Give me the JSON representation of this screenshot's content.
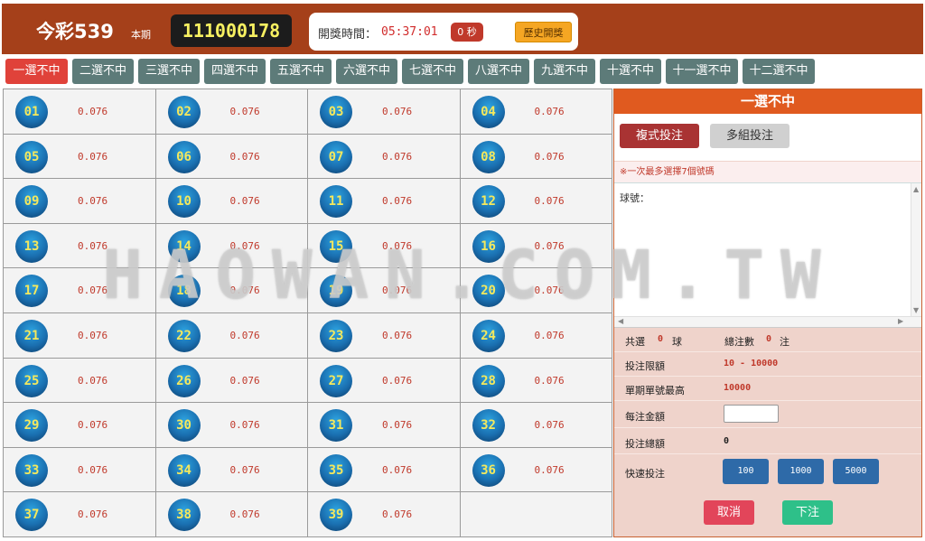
{
  "header": {
    "title": "今彩539",
    "period_label": "本期",
    "period_number": "111000178",
    "draw_time_label": "開獎時間：",
    "draw_time_value": "05:37:01",
    "seconds_label": "0 秒",
    "history_label": "歷史開獎",
    "bg_color": "#a5401a"
  },
  "tabs": [
    {
      "label": "一選不中",
      "active": true
    },
    {
      "label": "二選不中",
      "active": false
    },
    {
      "label": "三選不中",
      "active": false
    },
    {
      "label": "四選不中",
      "active": false
    },
    {
      "label": "五選不中",
      "active": false
    },
    {
      "label": "六選不中",
      "active": false
    },
    {
      "label": "七選不中",
      "active": false
    },
    {
      "label": "八選不中",
      "active": false
    },
    {
      "label": "九選不中",
      "active": false
    },
    {
      "label": "十選不中",
      "active": false
    },
    {
      "label": "十一選不中",
      "active": false
    },
    {
      "label": "十二選不中",
      "active": false
    }
  ],
  "numbers": [
    {
      "num": "01",
      "odds": "0.076"
    },
    {
      "num": "02",
      "odds": "0.076"
    },
    {
      "num": "03",
      "odds": "0.076"
    },
    {
      "num": "04",
      "odds": "0.076"
    },
    {
      "num": "05",
      "odds": "0.076"
    },
    {
      "num": "06",
      "odds": "0.076"
    },
    {
      "num": "07",
      "odds": "0.076"
    },
    {
      "num": "08",
      "odds": "0.076"
    },
    {
      "num": "09",
      "odds": "0.076"
    },
    {
      "num": "10",
      "odds": "0.076"
    },
    {
      "num": "11",
      "odds": "0.076"
    },
    {
      "num": "12",
      "odds": "0.076"
    },
    {
      "num": "13",
      "odds": "0.076"
    },
    {
      "num": "14",
      "odds": "0.076"
    },
    {
      "num": "15",
      "odds": "0.076"
    },
    {
      "num": "16",
      "odds": "0.076"
    },
    {
      "num": "17",
      "odds": "0.076"
    },
    {
      "num": "18",
      "odds": "0.076"
    },
    {
      "num": "19",
      "odds": "0.076"
    },
    {
      "num": "20",
      "odds": "0.076"
    },
    {
      "num": "21",
      "odds": "0.076"
    },
    {
      "num": "22",
      "odds": "0.076"
    },
    {
      "num": "23",
      "odds": "0.076"
    },
    {
      "num": "24",
      "odds": "0.076"
    },
    {
      "num": "25",
      "odds": "0.076"
    },
    {
      "num": "26",
      "odds": "0.076"
    },
    {
      "num": "27",
      "odds": "0.076"
    },
    {
      "num": "28",
      "odds": "0.076"
    },
    {
      "num": "29",
      "odds": "0.076"
    },
    {
      "num": "30",
      "odds": "0.076"
    },
    {
      "num": "31",
      "odds": "0.076"
    },
    {
      "num": "32",
      "odds": "0.076"
    },
    {
      "num": "33",
      "odds": "0.076"
    },
    {
      "num": "34",
      "odds": "0.076"
    },
    {
      "num": "35",
      "odds": "0.076"
    },
    {
      "num": "36",
      "odds": "0.076"
    },
    {
      "num": "37",
      "odds": "0.076"
    },
    {
      "num": "38",
      "odds": "0.076"
    },
    {
      "num": "39",
      "odds": "0.076"
    }
  ],
  "panel": {
    "title": "一選不中",
    "mode_compound": "複式投注",
    "mode_multi": "多組投注",
    "notice": "※一次最多選擇7個號碼",
    "balls_label": "球號：",
    "selected_label": "共選",
    "selected_value": "0",
    "selected_unit": "球",
    "bets_label": "總注數",
    "bets_value": "0",
    "bets_unit": "注",
    "limit_label": "投注限額",
    "limit_value": "10 - 10000",
    "max_label": "單期單號最高",
    "max_value": "10000",
    "per_bet_label": "每注金額",
    "per_bet_value": "",
    "total_label": "投注總額",
    "total_value": "0",
    "quick_label": "快速投注",
    "quick_amounts": [
      "100",
      "1000",
      "5000"
    ],
    "cancel_label": "取消",
    "submit_label": "下注"
  },
  "watermark": "HAOWAN.COM.TW"
}
